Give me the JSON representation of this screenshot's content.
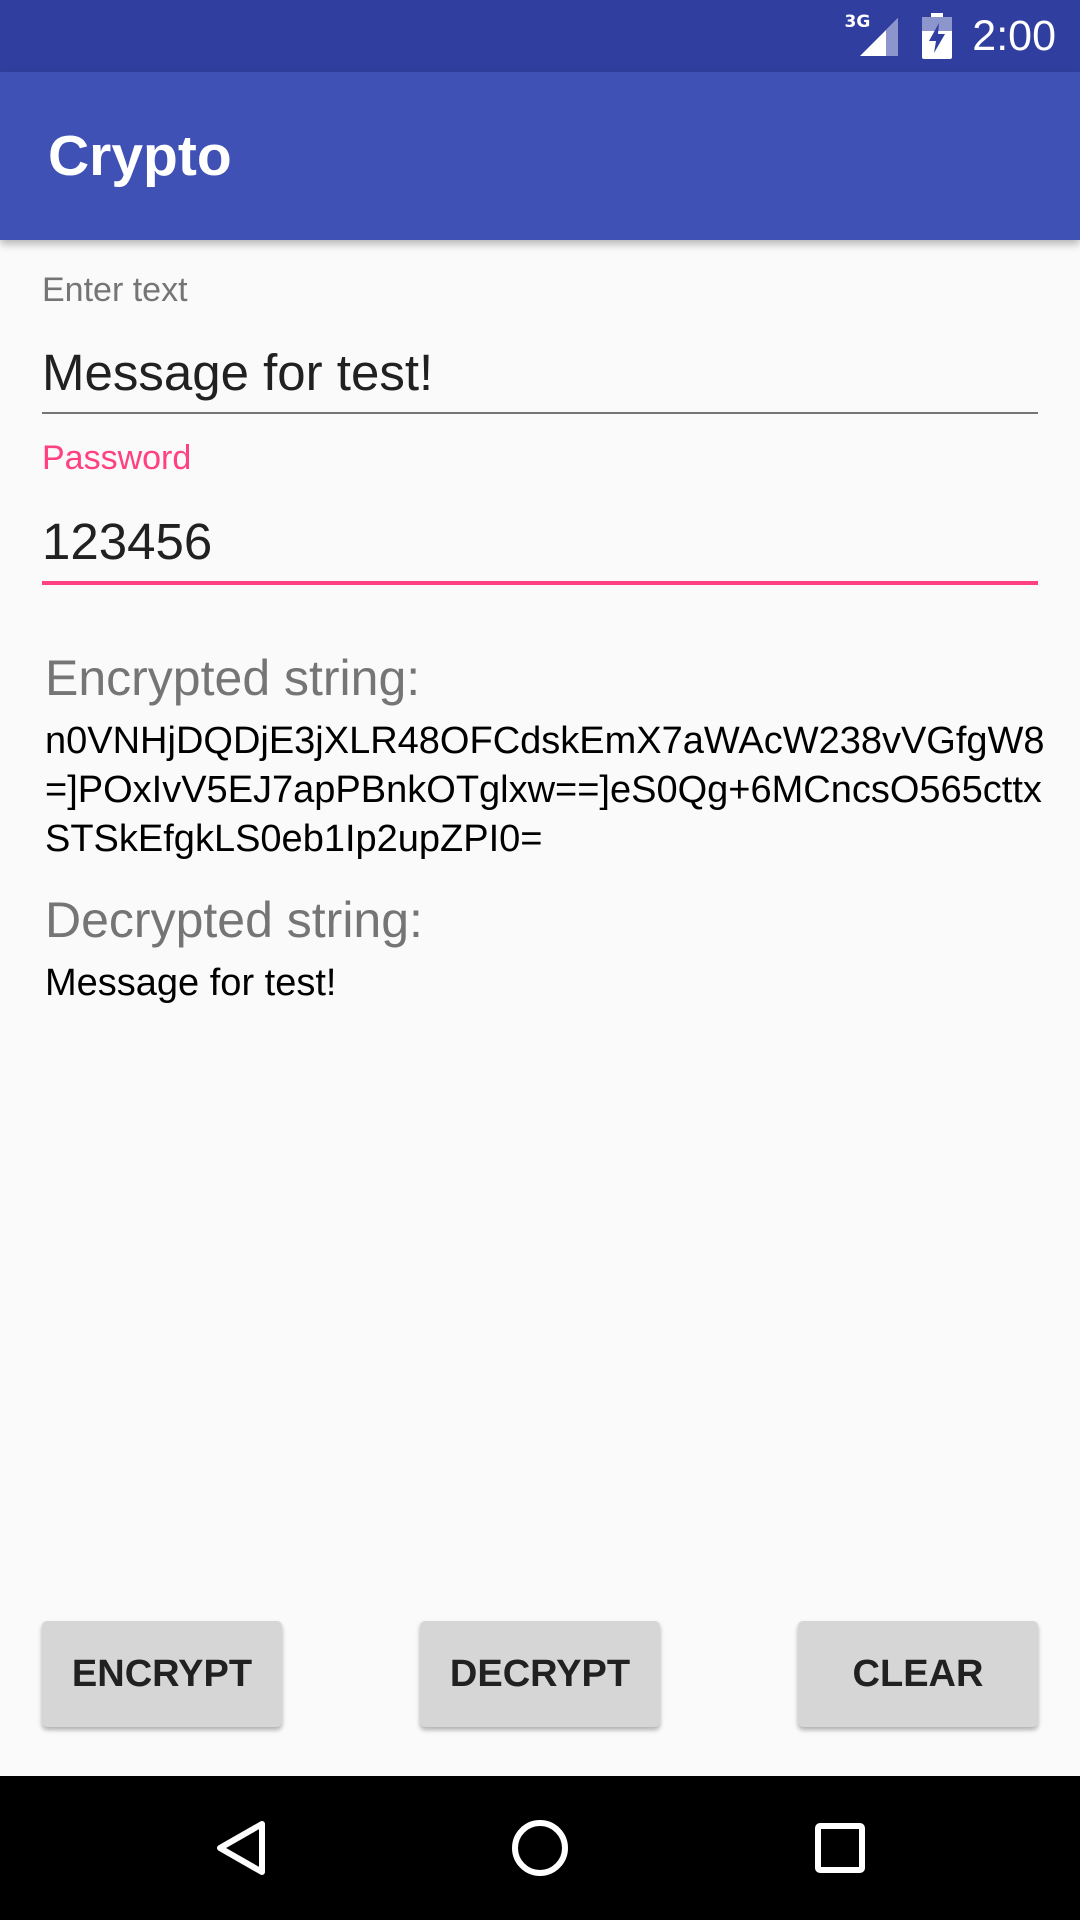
{
  "status_bar": {
    "network_type": "3G",
    "signal_icon": "cell-signal-icon",
    "battery_icon": "battery-charging-icon",
    "time": "2:00",
    "background_color": "#303f9f"
  },
  "app_bar": {
    "title": "Crypto",
    "background_color": "#3f51b5"
  },
  "text_field": {
    "label": "Enter text",
    "value": "Message for test!"
  },
  "password_field": {
    "label": "Password",
    "value": "123456",
    "accent_color": "#ff4081"
  },
  "encrypted": {
    "title": "Encrypted string:",
    "value": "n0VNHjDQDjE3jXLR48OFCdskEmX7aWAcW238vVGfgW8=]POxIvV5EJ7apPBnkOTglxw==]eS0Qg+6MCncsO565cttxSTSkEfgkLS0eb1Ip2upZPI0="
  },
  "decrypted": {
    "title": "Decrypted string:",
    "value": "Message for test!"
  },
  "buttons": {
    "encrypt": "ENCRYPT",
    "decrypt": "DECRYPT",
    "clear": "CLEAR"
  },
  "nav_bar": {
    "back_icon": "back-triangle-icon",
    "home_icon": "home-circle-icon",
    "recents_icon": "recents-square-icon"
  }
}
